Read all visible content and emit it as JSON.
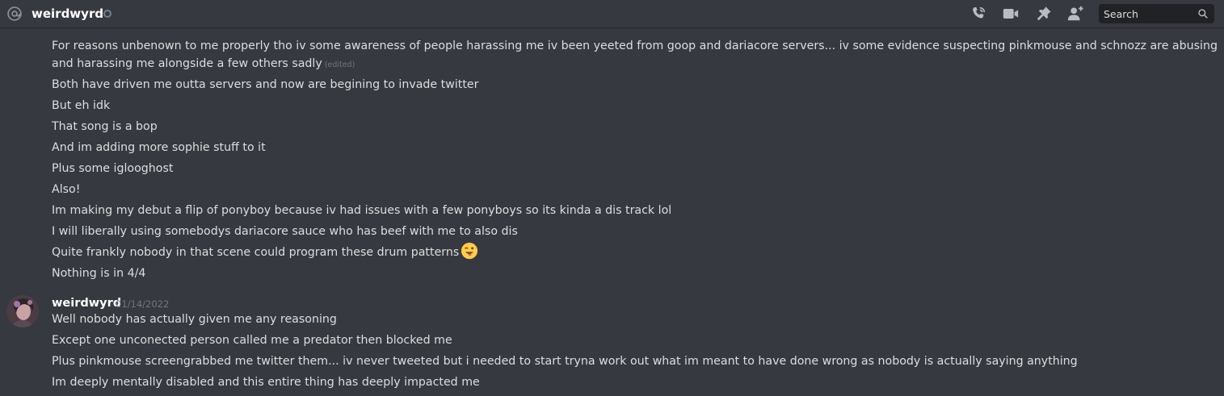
{
  "header": {
    "channel_name": "weirdwyrd",
    "search_placeholder": "Search",
    "icons": [
      "at-sign-icon",
      "status-idle-icon",
      "start-voice-call-icon",
      "start-video-call-icon",
      "pinned-messages-icon",
      "add-friends-to-dm-icon",
      "search-icon"
    ]
  },
  "messages": {
    "group1": {
      "first_message": "For reasons unbenown to me properly tho iv some awareness of people harassing me iv been yeeted from goop and dariacore servers... iv some evidence suspecting pinkmouse and schnozz are abusing and harassing me alongside a few others sadly",
      "edited_label": "(edited)",
      "lines": [
        "Both have driven me outta servers and now are begining to invade twitter",
        "But eh idk",
        "That song is a bop",
        "And im adding more sophie stuff to it",
        "Plus some iglooghost",
        "Also!",
        "Im making my debut a flip of ponyboy because iv had issues with a few ponyboys so its kinda a dis track lol",
        "I will liberally using somebodys dariacore sauce who has beef with me to also dis",
        "Quite frankly nobody in that scene could program these drum patterns",
        "Nothing is in 4/4"
      ],
      "emoji": "winking-face-with-tongue-icon"
    },
    "group2": {
      "author": "weirdwyrd",
      "timestamp": "01/14/2022",
      "lines": [
        "Well nobody has actually given me any reasoning",
        "Except one unconected person called me a predator then blocked me",
        "Plus pinkmouse screengrabbed me twitter them... iv never tweeted but i needed to start tryna work out what im meant to have done wrong as nobody is actually saying anything",
        "Im deeply mentally disabled and this entire thing has deeply impacted me"
      ]
    }
  },
  "colors": {
    "background": "#36393f",
    "text": "#dcddde",
    "muted": "#72767d",
    "icon": "#b9bbbe",
    "search_bg": "#202225"
  }
}
